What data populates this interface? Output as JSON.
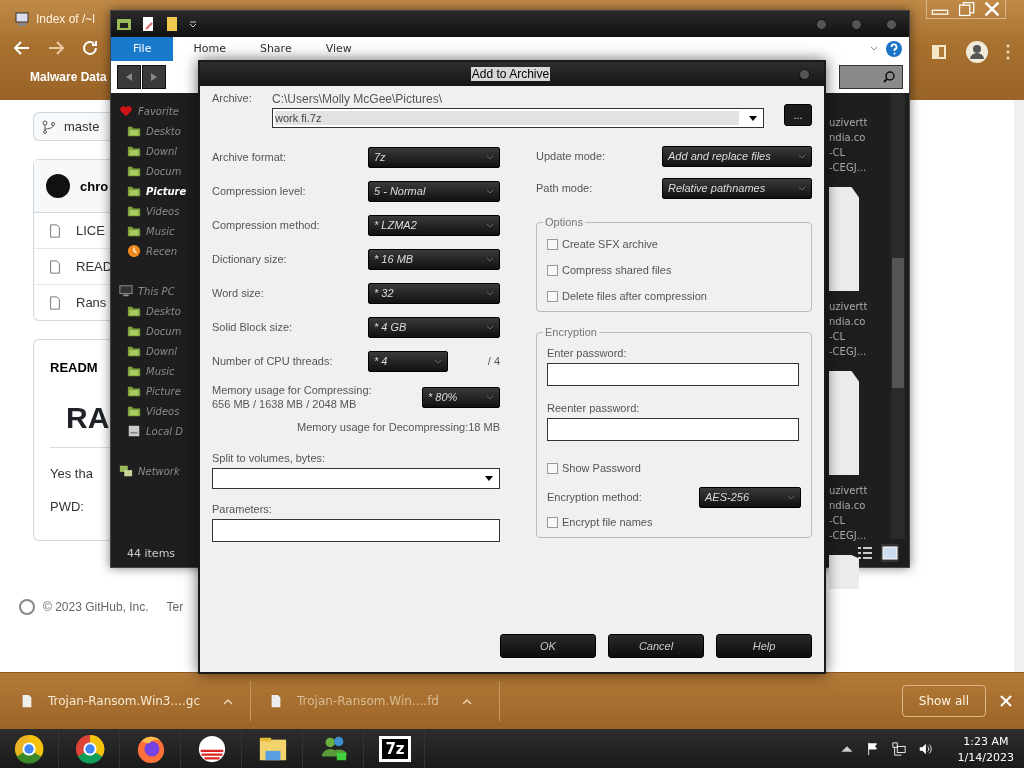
{
  "browser": {
    "tab_title": "Index of /~l",
    "bookmark": "Malware Data",
    "page": {
      "branch": "maste",
      "owner": "chro",
      "files": [
        "LICE",
        "READ",
        "Rans"
      ],
      "readme_label": "READM",
      "heading": "RA",
      "lines": [
        "Yes tha",
        "PWD:"
      ],
      "footer": "© 2023 GitHub, Inc.",
      "footer_link": "Ter"
    }
  },
  "explorer": {
    "ribbon_tabs": [
      {
        "label": "File",
        "selected": true
      },
      {
        "label": "Home",
        "selected": false
      },
      {
        "label": "Share",
        "selected": false
      },
      {
        "label": "View",
        "selected": false
      }
    ],
    "nav": [
      {
        "label": "Favorite",
        "kind": "heart",
        "selected": false,
        "children": [
          {
            "label": "Deskto",
            "kind": "folder",
            "selected": false
          },
          {
            "label": "Downl",
            "kind": "folder",
            "selected": false
          },
          {
            "label": "Docum",
            "kind": "folder",
            "selected": false
          },
          {
            "label": "Picture",
            "kind": "folder",
            "selected": true
          },
          {
            "label": "Videos",
            "kind": "folder",
            "selected": false
          },
          {
            "label": "Music",
            "kind": "folder",
            "selected": false
          },
          {
            "label": "Recen",
            "kind": "recent",
            "selected": false
          }
        ]
      },
      {
        "label": "This PC",
        "kind": "pc",
        "selected": false,
        "children": [
          {
            "label": "Deskto",
            "kind": "folder",
            "selected": false
          },
          {
            "label": "Docum",
            "kind": "folder",
            "selected": false
          },
          {
            "label": "Downl",
            "kind": "folder",
            "selected": false
          },
          {
            "label": "Music",
            "kind": "folder",
            "selected": false
          },
          {
            "label": "Picture",
            "kind": "folder",
            "selected": false
          },
          {
            "label": "Videos",
            "kind": "folder",
            "selected": false
          },
          {
            "label": "Local D",
            "kind": "drive",
            "selected": false
          }
        ]
      },
      {
        "label": "Network",
        "kind": "network",
        "selected": false
      }
    ],
    "files": [
      {
        "lines": [
          "uzivertt",
          "ndia.co",
          "-CL",
          "-CEGJ..."
        ]
      },
      {
        "lines": [
          "uzivertt",
          "ndia.co",
          "-CL",
          "-CEGJ..."
        ]
      },
      {
        "lines": [
          "uzivertt",
          "ndia.co",
          "-CL",
          "-CEGJ..."
        ]
      }
    ],
    "status": "44 items"
  },
  "dialog": {
    "title": "Add to Archive",
    "archive_label": "Archive:",
    "archive_path": "C:\\Users\\Molly McGee\\Pictures\\",
    "archive_name": "work fi.7z",
    "browse": "...",
    "settings": [
      {
        "kind": "select",
        "label": "Archive format:",
        "value": "7z"
      },
      {
        "kind": "select",
        "label": "Compression level:",
        "value": "5 - Normal"
      },
      {
        "kind": "select",
        "label": "Compression method:",
        "value": "* LZMA2"
      },
      {
        "kind": "select",
        "label": "Dictionary size:",
        "value": "* 16 MB"
      },
      {
        "kind": "select",
        "label": "Word size:",
        "value": "* 32"
      },
      {
        "kind": "select",
        "label": "Solid Block size:",
        "value": "* 4 GB"
      },
      {
        "kind": "threads",
        "label": "Number of CPU threads:",
        "value": "* 4",
        "suffix": "/ 4"
      },
      {
        "kind": "memory",
        "label": "Memory usage for Compressing:",
        "detail": "656 MB / 1638 MB / 2048 MB",
        "value": "* 80%"
      },
      {
        "kind": "reading",
        "label": "Memory usage for Decompressing:",
        "reading": "18 MB"
      }
    ],
    "split": {
      "label": "Split to volumes, bytes:"
    },
    "parameters": {
      "label": "Parameters:"
    },
    "modes": [
      {
        "label": "Update mode:",
        "value": "Add and replace files"
      },
      {
        "label": "Path mode:",
        "value": "Relative pathnames"
      }
    ],
    "options": {
      "title": "Options",
      "items": [
        {
          "label": "Create SFX archive",
          "checked": false
        },
        {
          "label": "Compress shared files",
          "checked": false
        },
        {
          "label": "Delete files after compression",
          "checked": false
        }
      ]
    },
    "encryption": {
      "title": "Encryption",
      "password_label": "Enter password:",
      "reenter_label": "Reenter password:",
      "show_password": {
        "label": "Show Password",
        "checked": false
      },
      "method_label": "Encryption method:",
      "method": "AES-256",
      "encrypt_names": {
        "label": "Encrypt file names",
        "checked": false
      }
    },
    "buttons": [
      "OK",
      "Cancel",
      "Help"
    ]
  },
  "downloads": {
    "items": [
      "Trojan-Ransom.Win3....gc",
      "Trojan-Ransom.Win....fd"
    ],
    "show_all": "Show all"
  },
  "taskbar": {
    "apps": [
      {
        "kind": "canary"
      },
      {
        "kind": "chrome"
      },
      {
        "kind": "firefox"
      },
      {
        "kind": "striped"
      },
      {
        "kind": "explorer"
      },
      {
        "kind": "people"
      },
      {
        "kind": "sevenzip",
        "label": "7z"
      }
    ],
    "clock": {
      "time": "1:23 AM",
      "date": "1/14/2023"
    }
  }
}
